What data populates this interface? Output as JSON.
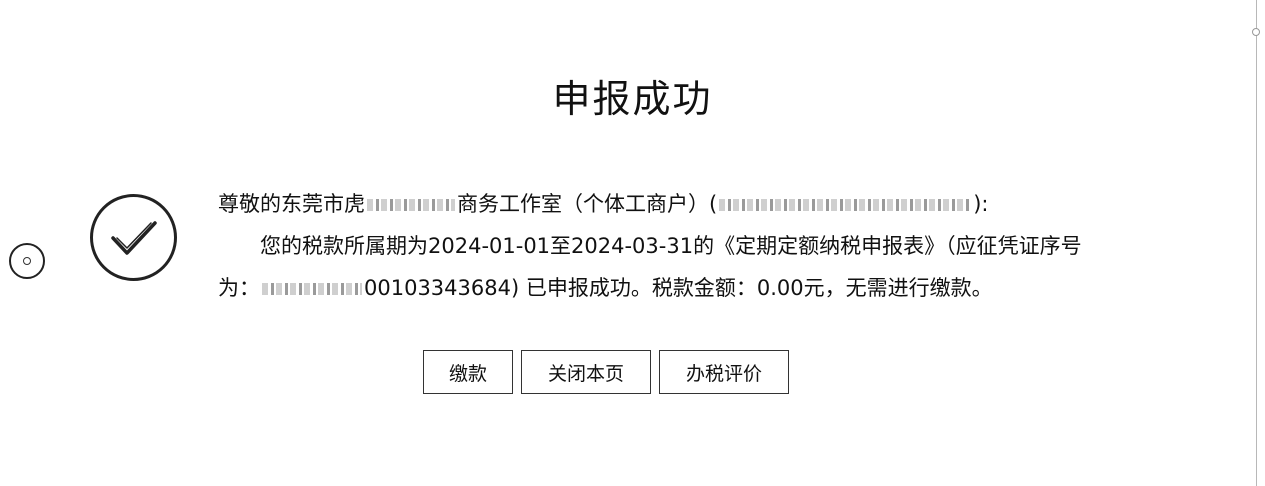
{
  "page": {
    "title": "申报成功"
  },
  "icons": {
    "status": "check-circle-icon",
    "side": "record-badge-icon"
  },
  "message": {
    "line1_prefix": "尊敬的东莞市虎",
    "line1_mid": "商务工作室（个体工商户）(",
    "line1_suffix": "):",
    "line2": "您的税款所属期为2024-01-01至2024-03-31的《定期定额纳税申报表》（应征凭证序号",
    "line3_prefix": "为：",
    "line3_serial_visible": "00103343684",
    "line3_suffix": ")  已申报成功。税款金额：0.00元，无需进行缴款。"
  },
  "buttons": {
    "pay": "缴款",
    "close": "关闭本页",
    "rate": "办税评价"
  }
}
